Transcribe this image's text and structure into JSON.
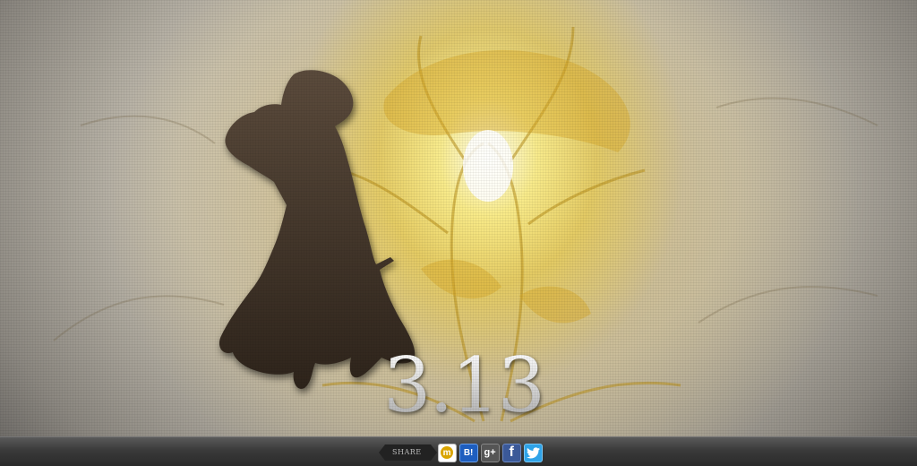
{
  "date_text": "3.13",
  "share": {
    "label": "SHARE",
    "buttons": [
      {
        "name": "mixi",
        "glyph": "m"
      },
      {
        "name": "hatena-bookmark",
        "glyph": "B!"
      },
      {
        "name": "google-plus",
        "glyph": "g+"
      },
      {
        "name": "facebook",
        "glyph": "f"
      },
      {
        "name": "twitter",
        "glyph": ""
      }
    ]
  },
  "colors": {
    "glow": "#f5e26a",
    "silhouette": "#3d3228",
    "footer": "#333333"
  }
}
